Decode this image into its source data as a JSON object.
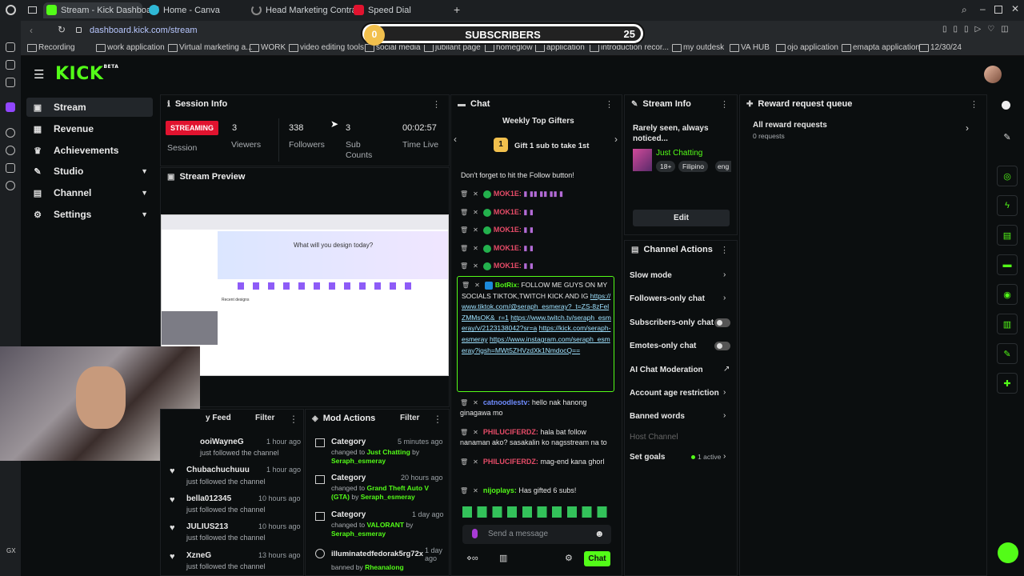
{
  "browser": {
    "tabs": [
      {
        "label": "Stream - Kick Dashboard"
      },
      {
        "label": "Home - Canva"
      },
      {
        "label": "Head Marketing Contract"
      },
      {
        "label": "Speed Dial"
      }
    ],
    "url": "dashboard.kick.com/stream",
    "bookmarks": [
      "Recording",
      "work application",
      "Virtual marketing a...",
      "WORK",
      "video editing tools",
      "social media",
      "jubilant page",
      "homeglow",
      "application",
      "introduction recor...",
      "my outdesk",
      "VA HUB",
      "ojo application",
      "emapta application",
      "12/30/24"
    ]
  },
  "overlay": {
    "sub_current": "0",
    "label": "SUBSCRIBERS",
    "sub_goal": "25"
  },
  "logo": {
    "text": "KICK",
    "beta": "BETA"
  },
  "sidebar": {
    "items": [
      {
        "label": "Stream",
        "icon": "stream-icon"
      },
      {
        "label": "Revenue",
        "icon": "revenue-icon"
      },
      {
        "label": "Achievements",
        "icon": "trophy-icon"
      },
      {
        "label": "Studio",
        "icon": "studio-icon"
      },
      {
        "label": "Channel",
        "icon": "channel-icon"
      },
      {
        "label": "Settings",
        "icon": "gear-icon"
      }
    ]
  },
  "session": {
    "title": "Session Info",
    "status": "STREAMING",
    "session_label": "Session",
    "viewers": "3",
    "viewers_label": "Viewers",
    "followers": "338",
    "followers_label": "Followers",
    "subs": "3",
    "subs_label": "Sub Counts",
    "time": "00:02:57",
    "time_label": "Time Live"
  },
  "preview": {
    "title": "Stream Preview",
    "canva_heading": "What will you design today?",
    "recent": "Recent designs"
  },
  "chat": {
    "title": "Chat",
    "top_gifters": "Weekly Top Gifters",
    "gift_cta": "Gift 1 sub to take 1st",
    "gift_rank": "1",
    "pinned": "Don't forget to hit the Follow button!",
    "messages": [
      {
        "user": "MOK1E:"
      },
      {
        "user": "MOK1E:"
      },
      {
        "user": "MOK1E:"
      },
      {
        "user": "MOK1E:"
      },
      {
        "user": "MOK1E:"
      }
    ],
    "bot": {
      "user": "BotRix:",
      "text": "FOLLOW ME GUYS ON MY SOCIALS TIKTOK,TWITCH KICK AND IG",
      "link1": "https://www.tiktok.com/@seraph_esmeray?_t=ZS-8zFelZMMsOK&_r=1",
      "link2": "https://www.twitch.tv/seraph_esmeray/v/2123138042?sr=a",
      "link3": "https://kick.com/seraph-esmeray",
      "link4": "https://www.instagram.com/seraph_esmeray?igsh=MWt5ZHVzdXk1NmdocQ=="
    },
    "m1": {
      "user": "catnoodlestv:",
      "text": "hello nak hanong ginagawa mo"
    },
    "m2": {
      "user": "PHILUCIFERDZ:",
      "text": "hala bat follow nanaman ako? sasakalin ko nagsstream na to"
    },
    "m3": {
      "user": "PHILUCIFERDZ:",
      "text": "mag-end kana ghorl"
    },
    "m4": {
      "user": "nijoplays:",
      "text": "Has gifted 6 subs!"
    },
    "placeholder": "Send a message",
    "send_label": "Chat"
  },
  "stream_info": {
    "title": "Stream Info",
    "stream_title": "Rarely seen, always noticed...",
    "category": "Just Chatting",
    "tags": [
      "18+",
      "Filipino",
      "eng"
    ],
    "edit_label": "Edit"
  },
  "channel_actions": {
    "title": "Channel Actions",
    "items": [
      "Slow mode",
      "Followers-only chat",
      "Subscribers-only chat",
      "Emotes-only chat",
      "AI Chat Moderation",
      "Account age restriction",
      "Banned words"
    ],
    "host": "Host Channel",
    "goals": "Set goals",
    "goals_status": "1 active"
  },
  "reward": {
    "title": "Reward request queue",
    "all": "All reward requests",
    "count": "0 requests"
  },
  "activity": {
    "filter": "Filter",
    "title": "y Feed",
    "rows": [
      {
        "name": "ooiWayneG",
        "time": "1 hour ago",
        "text": "just followed the channel"
      },
      {
        "name": "Chubachuchuuu",
        "time": "1 hour ago",
        "text": "just followed the channel"
      },
      {
        "name": "bella012345",
        "time": "10 hours ago",
        "text": "just followed the channel"
      },
      {
        "name": "JULIUS213",
        "time": "10 hours ago",
        "text": "just followed the channel"
      },
      {
        "name": "XzneG",
        "time": "13 hours ago",
        "text": "just followed the channel"
      }
    ]
  },
  "mod": {
    "title": "Mod Actions",
    "filter": "Filter",
    "rows": [
      {
        "name": "Category",
        "time": "5 minutes ago",
        "pre": "changed to",
        "target": "Just Chatting",
        "by": "by",
        "who": "Seraph_esmeray"
      },
      {
        "name": "Category",
        "time": "20 hours ago",
        "pre": "changed to",
        "target": "Grand Theft Auto V (GTA)",
        "by": "by",
        "who": "Seraph_esmeray"
      },
      {
        "name": "Category",
        "time": "1 day ago",
        "pre": "changed to",
        "target": "VALORANT",
        "by": "by",
        "who": "Seraph_esmeray"
      },
      {
        "name": "illuminatedfedorak5rg72x",
        "time": "1 day ago",
        "pre": "banned by",
        "target": "",
        "by": "",
        "who": "Rheanalong"
      }
    ]
  },
  "colors": {
    "accent": "#53fc18",
    "live": "#e1132f"
  }
}
